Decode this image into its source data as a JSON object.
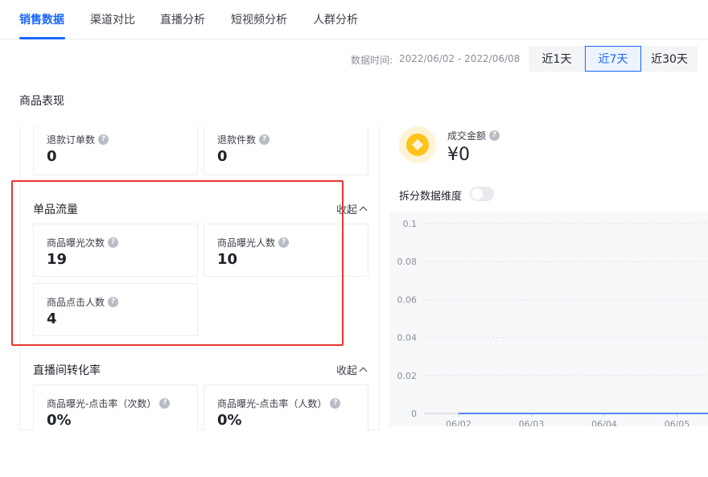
{
  "tabs": [
    {
      "label": "销售数据",
      "active": true
    },
    {
      "label": "渠道对比",
      "active": false
    },
    {
      "label": "直播分析",
      "active": false
    },
    {
      "label": "短视频分析",
      "active": false
    },
    {
      "label": "人群分析",
      "active": false
    }
  ],
  "date_filter": {
    "label": "数据时间:",
    "value": "2022/06/02 - 2022/06/08",
    "ranges": [
      {
        "label": "近1天",
        "active": false
      },
      {
        "label": "近7天",
        "active": true
      },
      {
        "label": "近30天",
        "active": false
      }
    ]
  },
  "section": {
    "title": "商品表现"
  },
  "refund": {
    "orders": {
      "label": "退款订单数",
      "value": "0"
    },
    "items": {
      "label": "退款件数",
      "value": "0"
    }
  },
  "single_flow": {
    "title": "单品流量",
    "collapse_label": "收起",
    "exposure_count": {
      "label": "商品曝光次数",
      "value": "19"
    },
    "exposure_users": {
      "label": "商品曝光人数",
      "value": "10"
    },
    "click_users": {
      "label": "商品点击人数",
      "value": "4"
    }
  },
  "live_conversion": {
    "title": "直播间转化率",
    "collapse_label": "收起",
    "ctr_times": {
      "label": "商品曝光-点击率（次数）",
      "value": "0%"
    },
    "ctr_users": {
      "label": "商品曝光-点击率（人数）",
      "value": "0%"
    }
  },
  "gmv": {
    "label": "成交金额",
    "value": "¥0"
  },
  "split": {
    "label": "拆分数据维度",
    "enabled": false
  },
  "colors": {
    "accent": "#1966ff",
    "highlight": "#e8362e",
    "coin": "#ffc21a"
  },
  "chart_data": {
    "type": "line",
    "x": [
      "06/02",
      "06/03",
      "06/04",
      "06/05"
    ],
    "series": [
      {
        "values": [
          0,
          0,
          0,
          0
        ]
      }
    ],
    "y_ticks": [
      "0.1",
      "0.08",
      "0.06",
      "0.04",
      "0.02",
      "0"
    ],
    "ylim": [
      0,
      0.1
    ],
    "grid": true
  }
}
